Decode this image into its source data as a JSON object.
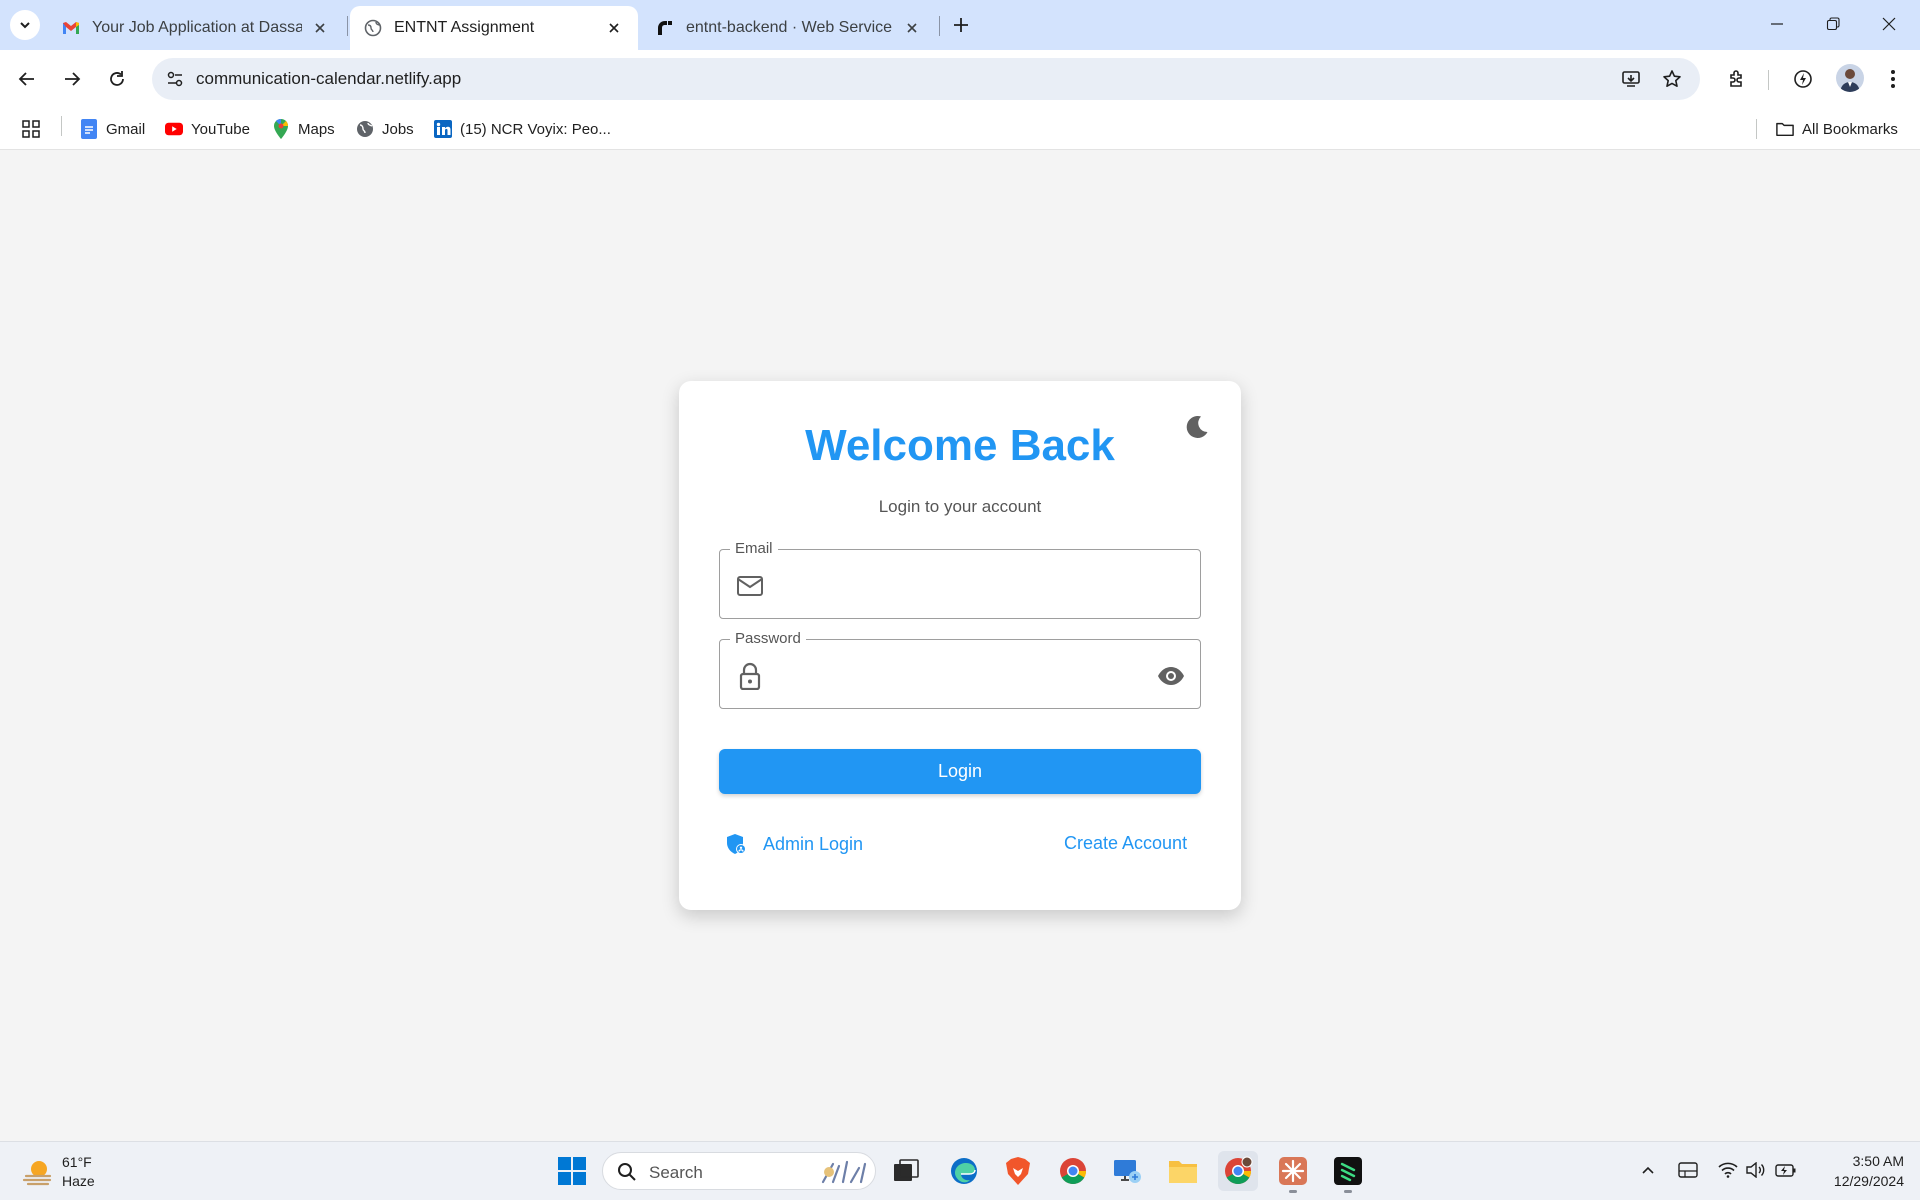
{
  "browser": {
    "tabs": [
      {
        "title": "Your Job Application at Dassault",
        "icon": "gmail-icon",
        "active": false
      },
      {
        "title": "ENTNT Assignment",
        "icon": "globe-icon",
        "active": true
      },
      {
        "title": "entnt-backend · Web Service ·",
        "icon": "render-icon",
        "active": false
      }
    ],
    "url": "communication-calendar.netlify.app",
    "bookmarks": [
      {
        "label": "Gmail",
        "icon": "google-docs-icon"
      },
      {
        "label": "YouTube",
        "icon": "youtube-icon"
      },
      {
        "label": "Maps",
        "icon": "maps-icon"
      },
      {
        "label": "Jobs",
        "icon": "globe-icon"
      },
      {
        "label": "(15) NCR Voyix: Peo...",
        "icon": "linkedin-icon"
      }
    ],
    "all_bookmarks_label": "All Bookmarks"
  },
  "login": {
    "title": "Welcome Back",
    "subtitle": "Login to your account",
    "email_label": "Email",
    "email_value": "",
    "password_label": "Password",
    "password_value": "",
    "login_button": "Login",
    "admin_link": "Admin Login",
    "create_link": "Create Account"
  },
  "taskbar": {
    "weather_temp": "61°F",
    "weather_desc": "Haze",
    "search_placeholder": "Search",
    "time": "3:50 AM",
    "date": "12/29/2024"
  },
  "colors": {
    "accent": "#2196f3",
    "page_bg": "#f4f4f4",
    "chrome_tabstrip": "#d3e3fd"
  }
}
